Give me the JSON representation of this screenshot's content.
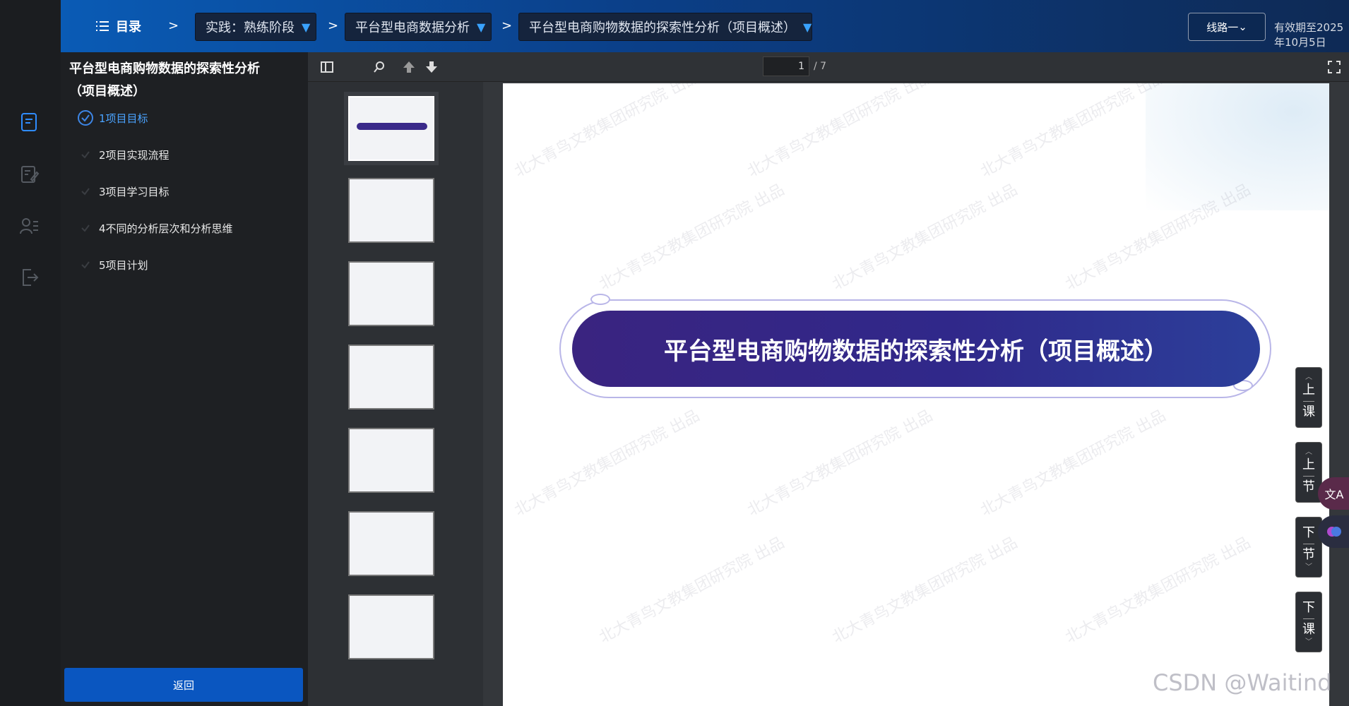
{
  "header": {
    "toc_label": "目录",
    "separator": ">",
    "crumbs": [
      {
        "label": "实践：熟练阶段",
        "caret": "▼"
      },
      {
        "label": "平台型电商数据分析",
        "caret": "▼"
      },
      {
        "label": "平台型电商购物数据的探索性分析（项目概述）",
        "caret": "▼"
      }
    ],
    "route_label": "线路一",
    "route_caret": "⌄",
    "valid_until": "有效期至2025年10月5日"
  },
  "outline": {
    "title": "平台型电商购物数据的探索性分析（项目概述）",
    "lessons": [
      {
        "label": "1项目目标",
        "done": true
      },
      {
        "label": "2项目实现流程",
        "done": false
      },
      {
        "label": "3项目学习目标",
        "done": false
      },
      {
        "label": "4不同的分析层次和分析思维",
        "done": false
      },
      {
        "label": "5项目计划",
        "done": false
      }
    ],
    "back_label": "返回"
  },
  "viewer": {
    "current_page": "1",
    "page_total": "/ 7",
    "slide_title": "平台型电商购物数据的探索性分析（项目概述）",
    "watermark": "北大青鸟文教集团研究院 出品",
    "thumb_count": 7
  },
  "sidenav": {
    "prev_lesson": [
      "上",
      "课"
    ],
    "prev_section": [
      "上",
      "节"
    ],
    "next_section": [
      "下",
      "节"
    ],
    "next_lesson": [
      "下",
      "课"
    ]
  },
  "floating": {
    "translate_icon": "⽂A",
    "brain_icon": "brain-icon"
  },
  "credit": "CSDN @Waitind",
  "colors": {
    "header_start": "#0a5bb5",
    "accent": "#0a56c0",
    "done_blue": "#4aa3ff",
    "banner": "#3a2480"
  }
}
